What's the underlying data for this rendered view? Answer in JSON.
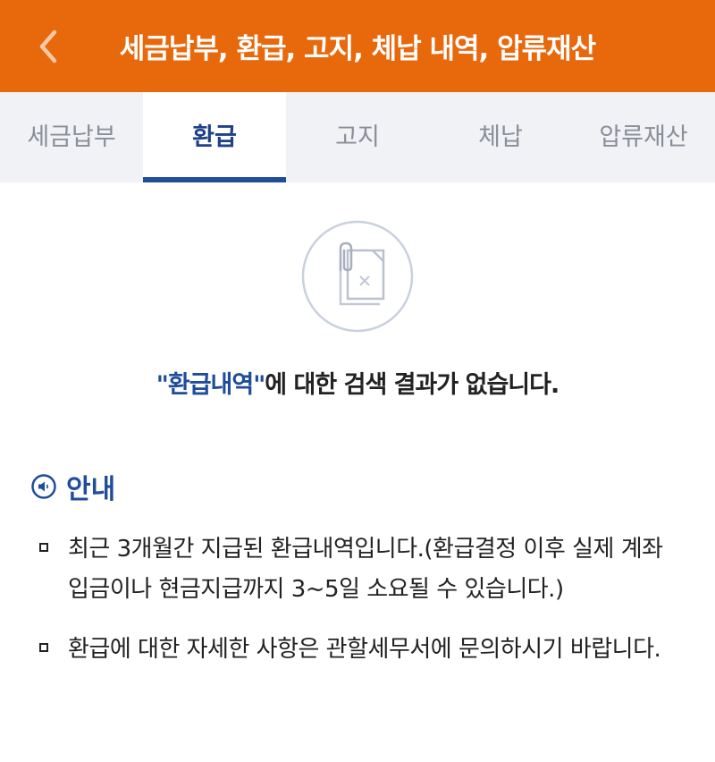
{
  "header": {
    "title": "세금납부, 환급, 고지, 체납 내역, 압류재산",
    "back_icon": "chevron-left-icon",
    "bg_color": "#e8680c"
  },
  "tabs": [
    {
      "label": "세금납부",
      "active": false
    },
    {
      "label": "환급",
      "active": true
    },
    {
      "label": "고지",
      "active": false
    },
    {
      "label": "체납",
      "active": false
    },
    {
      "label": "압류재산",
      "active": false
    }
  ],
  "empty_state": {
    "icon": "empty-document-icon",
    "keyword": "\"환급내역\"",
    "message": "에 대한 검색 결과가 없습니다."
  },
  "notice": {
    "icon": "speaker-icon",
    "title": "안내",
    "items": [
      "최근 3개월간 지급된 환급내역입니다.(환급결정 이후 실제 계좌 입금이나 현금지급까지 3~5일 소요될 수 있습니다.)",
      "환급에 대한 자세한 사항은 관할세무서에 문의하시기 바랍니다."
    ]
  },
  "colors": {
    "accent": "#1f4c9b",
    "tab_bg": "#f1f2f6"
  }
}
